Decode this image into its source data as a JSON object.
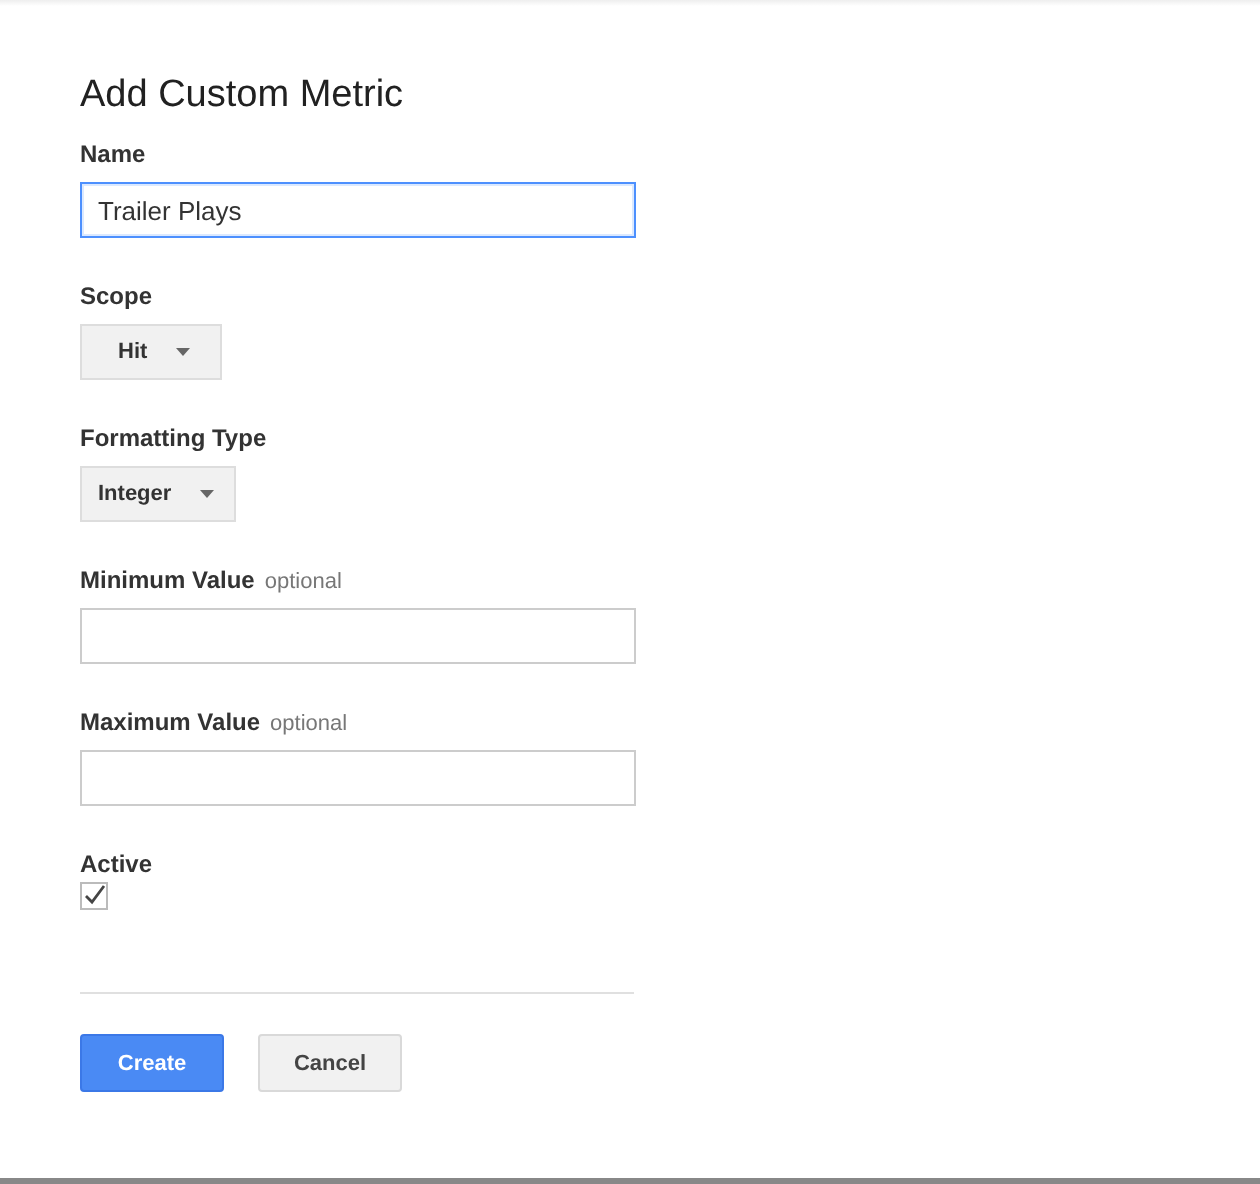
{
  "dialog": {
    "title": "Add Custom Metric",
    "fields": [
      {
        "kind": "text",
        "label": "Name",
        "value": "Trailer Plays",
        "focused": true
      },
      {
        "kind": "dropdown",
        "label": "Scope",
        "value": "Hit"
      },
      {
        "kind": "dropdown",
        "label": "Formatting Type",
        "value": "Integer"
      },
      {
        "kind": "text",
        "label": "Minimum Value",
        "hint": "optional",
        "focused": false
      },
      {
        "kind": "text",
        "label": "Maximum Value",
        "hint": "optional",
        "focused": false
      },
      {
        "kind": "checkbox",
        "label": "Active",
        "checked": true
      }
    ],
    "buttons": [
      {
        "label": "Create",
        "kind": "primary"
      },
      {
        "label": "Cancel",
        "kind": "secondary"
      }
    ]
  }
}
